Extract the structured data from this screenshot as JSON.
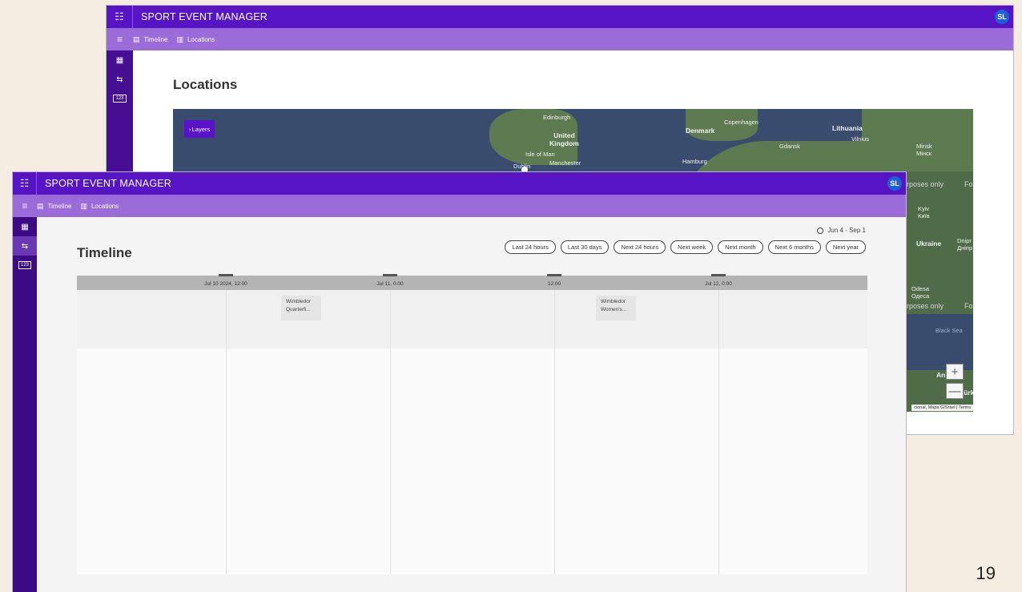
{
  "app": {
    "title": "SPORT EVENT MANAGER",
    "avatar": "SL"
  },
  "nav": {
    "timeline": "Timeline",
    "locations": "Locations"
  },
  "sidenav": {
    "icons": [
      "grid-icon",
      "timeline-icon",
      "number-icon"
    ]
  },
  "locations_page": {
    "title": "Locations",
    "layers_button": "Layers",
    "zoom_in": "+",
    "zoom_out": "—",
    "attribution": "cional, Mapa GISrael | Terms",
    "labels": {
      "edinburgh": "Edinburgh",
      "united_kingdom": "United\nKingdom",
      "isle_of_man": "Isle of Man",
      "manchester": "Manchester",
      "dublin": "Dublin",
      "denmark": "Denmark",
      "copenhagen": "Copenhagen",
      "lithuania": "Lithuania",
      "vilnius": "Vilnius",
      "gdansk": "Gdansk",
      "minsk": "Minsk\nМінск",
      "hamburg": "Hamburg",
      "purposes1": "rposes only",
      "fo1": "Fo",
      "kyiv": "Kyiv\nКиїв",
      "ukraine": "Ukraine",
      "dnipro": "Dnipr\nДніпр",
      "odesa": "Odesa\nОдеса",
      "purposes2": "rposes only",
      "fo2": "Fo",
      "black_sea": "Black Sea",
      "ank": "Ank",
      "turk": "Türk"
    }
  },
  "timeline_page": {
    "title": "Timeline",
    "range": "Jun 4 - Sep 1",
    "quick_ranges": [
      "Last 24 hours",
      "Last 30 days",
      "Next 24 hours",
      "Next week",
      "Next month",
      "Next 6 months",
      "Next year"
    ],
    "axis_ticks": [
      "Jul 10 2024, 12:00",
      "Jul 11, 0:00",
      "12:00",
      "Jul 12, 0:00"
    ],
    "events": [
      {
        "line1": "Wimbledor",
        "line2": "Quarterfi..."
      },
      {
        "line1": "Wimbledor",
        "line2": "Women's..."
      }
    ]
  },
  "slide": {
    "page_number": "19"
  }
}
